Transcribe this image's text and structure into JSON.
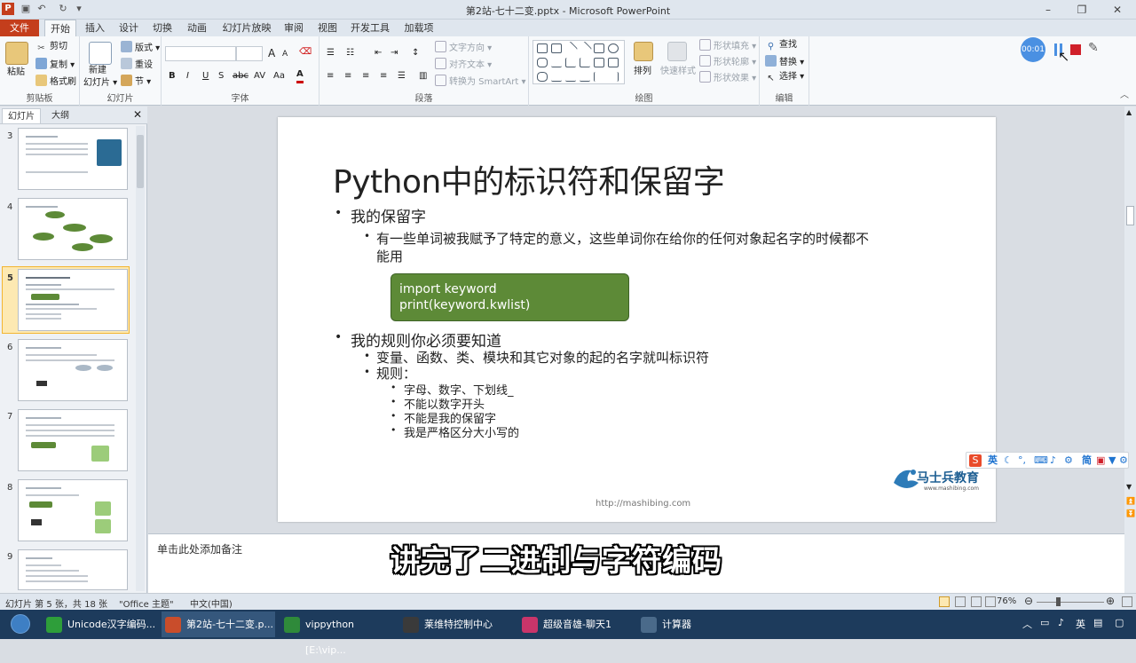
{
  "window": {
    "title": "第2站-七十二变.pptx - Microsoft PowerPoint"
  },
  "ribbon_tabs": [
    "文件",
    "开始",
    "插入",
    "设计",
    "切换",
    "动画",
    "幻灯片放映",
    "审阅",
    "视图",
    "开发工具",
    "加载项"
  ],
  "clipboard": {
    "paste": "粘贴",
    "cut": "剪切",
    "copy": "复制",
    "format_painter": "格式刷",
    "group": "剪贴板"
  },
  "slides_group": {
    "new_slide": "新建",
    "new_slide2": "幻灯片",
    "layout": "版式",
    "reset": "重设",
    "section": "节",
    "group": "幻灯片"
  },
  "font_group": {
    "group": "字体",
    "bold": "B",
    "italic": "I",
    "underline": "U",
    "shadow": "S",
    "strike": "abc",
    "spacing": "AV",
    "case": "Aa",
    "grow": "A",
    "shrink": "A"
  },
  "paragraph_group": {
    "group": "段落",
    "text_direction": "文字方向",
    "align_text": "对齐文本",
    "smartart": "转换为 SmartArt"
  },
  "drawing_group": {
    "group": "绘图",
    "arrange": "排列",
    "quick_styles": "快速样式",
    "fill": "形状填充",
    "outline": "形状轮廓",
    "effects": "形状效果"
  },
  "editing_group": {
    "group": "编辑",
    "find": "查找",
    "replace": "替换",
    "select": "选择"
  },
  "recording": {
    "time": "00:01"
  },
  "pane_tabs": {
    "slides": "幻灯片",
    "outline": "大纲"
  },
  "thumbnails": [
    {
      "num": "3"
    },
    {
      "num": "4"
    },
    {
      "num": "5"
    },
    {
      "num": "6"
    },
    {
      "num": "7"
    },
    {
      "num": "8"
    },
    {
      "num": "9"
    }
  ],
  "slide": {
    "title": "Python中的标识符和保留字",
    "b1": "我的保留字",
    "b1_sub_line1": "有一些单词被我赋予了特定的意义，这些单词你在给你的任何对象起名字的时候都不",
    "b1_sub_line2": "能用",
    "code_line1": "import  keyword",
    "code_line2": "print(keyword.kwlist)",
    "b2": "我的规则你必须要知道",
    "b2_sub1": "变量、函数、类、模块和其它对象的起的名字就叫标识符",
    "b2_sub2": "规则：",
    "rules": [
      "字母、数字、下划线_",
      "不能以数字开头",
      "不能是我的保留字",
      "我是严格区分大小写的"
    ],
    "url": "http://mashibing.com",
    "logo_text": "马士兵教育",
    "logo_sub": "www.mashibing.com"
  },
  "notes": {
    "placeholder": "单击此处添加备注"
  },
  "subtitle": "讲完了二进制与字符编码",
  "ime": {
    "lang": "英",
    "simp": "简"
  },
  "status": {
    "slide_info": "幻灯片 第 5 张，共 18 张",
    "theme": "\"Office 主题\"",
    "language": "中文(中国)",
    "zoom": "76%"
  },
  "taskbar": [
    {
      "label": "Unicode汉字编码...",
      "color": "#2e9e3a"
    },
    {
      "label": "第2站-七十二变.p...",
      "color": "#c94d2b"
    },
    {
      "label": "vippython [E:\\vip...",
      "color": "#2f8a3a"
    },
    {
      "label": "莱维特控制中心",
      "color": "#3a3a3a"
    },
    {
      "label": "超级音雄-聊天1",
      "color": "#c9356a"
    },
    {
      "label": "计算器",
      "color": "#4a6a8a"
    }
  ],
  "tray": {
    "lang": "英"
  }
}
